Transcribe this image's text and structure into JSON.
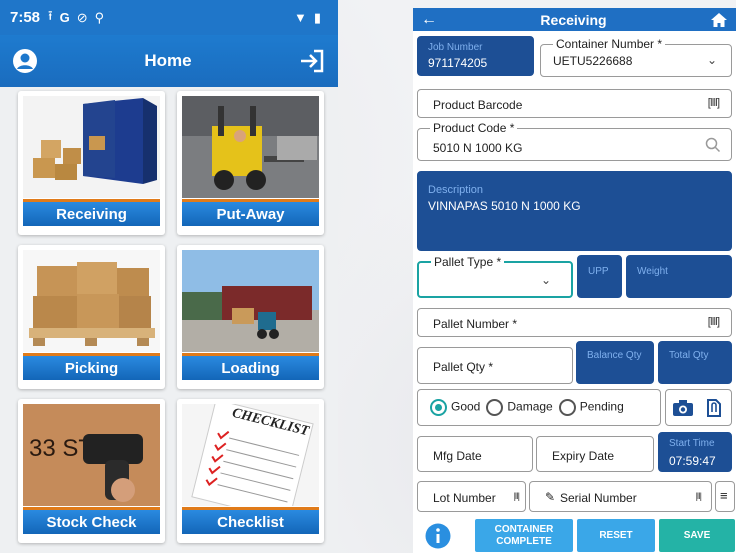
{
  "home": {
    "status_time": "7:58",
    "status_icons": [
      "upload-icon",
      "google-icon",
      "blocked-icon",
      "usb-icon"
    ],
    "title": "Home",
    "tiles": [
      {
        "label": "Receiving"
      },
      {
        "label": "Put-Away"
      },
      {
        "label": "Picking"
      },
      {
        "label": "Loading"
      },
      {
        "label": "Stock Check"
      },
      {
        "label": "Checklist"
      }
    ],
    "checklist_text": "CHECKLIST",
    "colors": {
      "primary": "#1f76c9",
      "accent": "#e07b1a"
    }
  },
  "receiving": {
    "title": "Receiving",
    "job_number_label": "Job Number",
    "job_number": "971174205",
    "container_number_label": "Container Number *",
    "container_number": "UETU5226688",
    "product_barcode": "Product Barcode",
    "product_code_label": "Product Code *",
    "product_code": "5010 N 1000 KG",
    "description_label": "Description",
    "description": "VINNAPAS 5010 N 1000 KG",
    "pallet_type_label": "Pallet Type *",
    "upp_label": "UPP",
    "weight_label": "Weight",
    "pallet_number": "Pallet Number *",
    "pallet_qty": "Pallet Qty *",
    "balance_qty_label": "Balance Qty",
    "total_qty_label": "Total Qty",
    "condition_options": [
      "Good",
      "Damage",
      "Pending"
    ],
    "mfg_date": "Mfg Date",
    "expiry_date": "Expiry Date",
    "start_time_label": "Start Time",
    "start_time": "07:59:47",
    "lot_number": "Lot Number",
    "serial_number": "Serial Number",
    "buttons": {
      "container_complete": "CONTAINER COMPLETE",
      "reset": "RESET",
      "save": "SAVE"
    },
    "colors": {
      "field_blue": "#1d4f95",
      "teal": "#1aa3a3",
      "button_blue": "#3aa7e8",
      "save": "#24b3a6"
    }
  }
}
